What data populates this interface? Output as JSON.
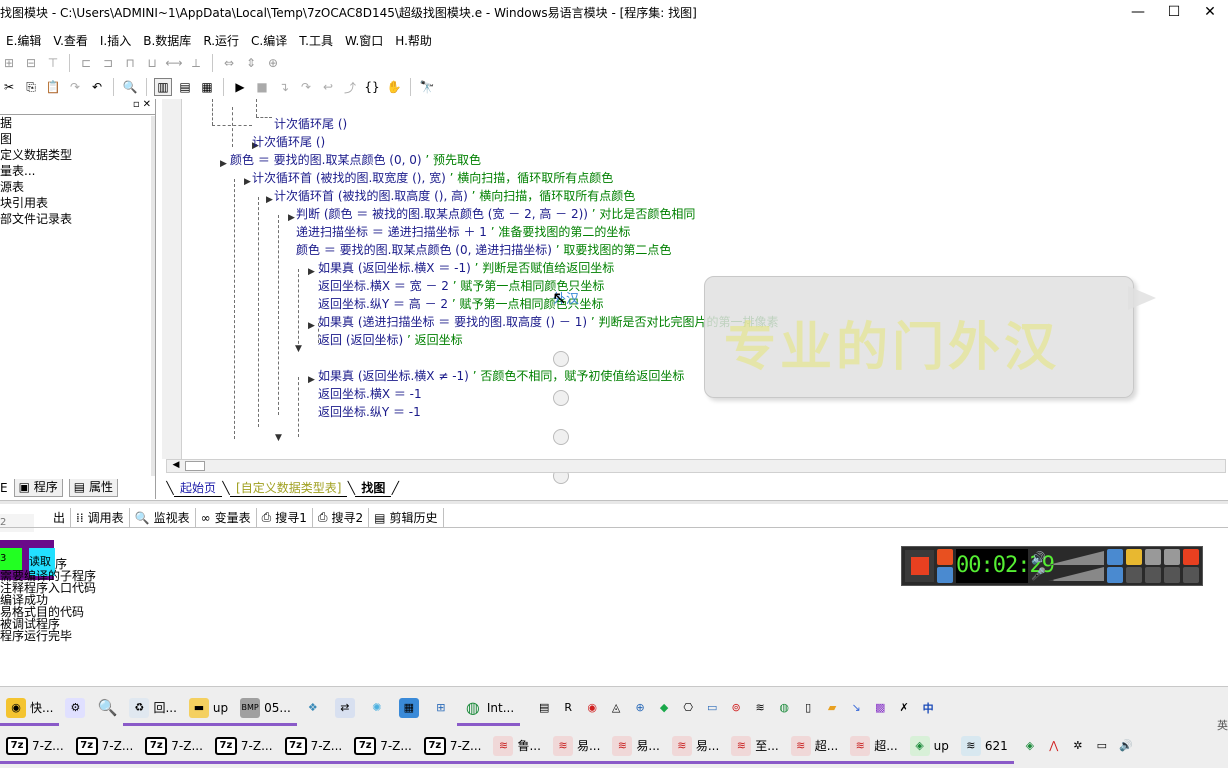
{
  "window": {
    "title": "找图模块 - C:\\Users\\ADMINI~1\\AppData\\Local\\Temp\\7zOCAC8D145\\超级找图模块.e - Windows易语言模块 - [程序集: 找图]",
    "minimize": "—",
    "maximize": "☐",
    "close": "✕"
  },
  "menu": {
    "items": [
      "E.编辑",
      "V.查看",
      "I.插入",
      "B.数据库",
      "R.运行",
      "C.编译",
      "T.工具",
      "W.窗口",
      "H.帮助"
    ]
  },
  "left_panel": {
    "tree": [
      "据",
      "图",
      "定义数据类型",
      "量表...",
      "源表",
      "块引用表",
      "部文件记录表"
    ],
    "tabs": [
      "程序",
      "属性"
    ],
    "tab_prefix": "E"
  },
  "code": {
    "lines": [
      {
        "kw": "计次循环尾 ()",
        "cm": ""
      },
      {
        "kw": "计次循环尾 ()",
        "cm": ""
      },
      {
        "kw": "颜色 ＝ 要找的图.取某点颜色 (0, 0)",
        "cm": "’ 预先取色"
      },
      {
        "kw": "计次循环首 (被找的图.取宽度 (), 宽)",
        "cm": "’ 横向扫描，循环取所有点颜色"
      },
      {
        "kw": "计次循环首 (被找的图.取高度 (), 高)",
        "cm": "’ 横向扫描，循环取所有点颜色"
      },
      {
        "kw": "判断 (颜色 ＝ 被找的图.取某点颜色 (宽 － 2, 高 － 2))",
        "cm": "’ 对比是否颜色相同"
      },
      {
        "kw": "递进扫描坐标 ＝ 递进扫描坐标 ＋ 1",
        "cm": "’ 准备要找图的第二的坐标"
      },
      {
        "kw": "颜色 ＝ 要找的图.取某点颜色 (0, 递进扫描坐标)",
        "cm": "’ 取要找图的第二点色"
      },
      {
        "kw": "如果真 (返回坐标.横X ＝ -1)",
        "cm": "’ 判断是否赋值给返回坐标"
      },
      {
        "kw": "返回坐标.横X ＝ 宽 － 2",
        "cm": "’ 赋予第一点相同颜色只坐标"
      },
      {
        "kw": "返回坐标.纵Y ＝ 高 － 2",
        "cm": "’ 赋予第一点相同颜色只坐标"
      },
      {
        "kw": "如果真 (递进扫描坐标 ＝ 要找的图.取高度 () － 1)",
        "cm": "’ 判断是否对比完图片的第一排像素"
      },
      {
        "kw": "返回 (返回坐标)",
        "cm": "’ 返回坐标"
      },
      {
        "kw": "如果真 (返回坐标.横X ≠ -1)",
        "cm": "’ 否颜色不相同，赋予初使值给返回坐标"
      },
      {
        "kw": "返回坐标.横X ＝ -1",
        "cm": ""
      },
      {
        "kw": "返回坐标.纵Y ＝ -1",
        "cm": ""
      }
    ]
  },
  "editor_tabs": [
    "起始页",
    "[自定义数据类型表]",
    "找图"
  ],
  "bottom_tabs": [
    "出",
    "调用表",
    "监视表",
    "变量表",
    "搜寻1",
    "搜寻2",
    "剪辑历史"
  ],
  "bottom_input_value": "2",
  "output": {
    "lines": [
      "序",
      "需要编译的子程序",
      "注释程序入口代码",
      "编译成功",
      "易格式目的代码",
      "被调试程序",
      "程序运行完毕"
    ],
    "green_label": "3",
    "cyan_label": "读取"
  },
  "recorder": {
    "timer": "00:02:29"
  },
  "bubble": {
    "text": "专业的门外汉",
    "cursor_label": "外汉"
  },
  "taskbar": {
    "row1": [
      {
        "icon": "chrome-icon",
        "label": "快..."
      },
      {
        "icon": "app-icon",
        "label": ""
      },
      {
        "icon": "search-app-icon",
        "label": ""
      },
      {
        "icon": "recycle-icon",
        "label": "回..."
      },
      {
        "icon": "folder-icon",
        "label": "up"
      },
      {
        "icon": "bmp-icon",
        "label": "05..."
      },
      {
        "icon": "app-icon",
        "label": ""
      },
      {
        "icon": "app-icon",
        "label": ""
      },
      {
        "icon": "app-icon",
        "label": ""
      },
      {
        "icon": "app-icon",
        "label": ""
      },
      {
        "icon": "network-icon",
        "label": ""
      },
      {
        "icon": "ie-icon",
        "label": "Int..."
      }
    ],
    "row2": [
      {
        "icon": "7z-icon",
        "label": "7-Z..."
      },
      {
        "icon": "7z-icon",
        "label": "7-Z..."
      },
      {
        "icon": "7z-icon",
        "label": "7-Z..."
      },
      {
        "icon": "7z-icon",
        "label": "7-Z..."
      },
      {
        "icon": "7z-icon",
        "label": "7-Z..."
      },
      {
        "icon": "7z-icon",
        "label": "7-Z..."
      },
      {
        "icon": "7z-icon",
        "label": "7-Z..."
      },
      {
        "icon": "e-icon",
        "label": "鲁..."
      },
      {
        "icon": "e-icon",
        "label": "易..."
      },
      {
        "icon": "e-icon",
        "label": "易..."
      },
      {
        "icon": "e-icon",
        "label": "易..."
      },
      {
        "icon": "e-icon",
        "label": "至..."
      },
      {
        "icon": "e-icon",
        "label": "超..."
      },
      {
        "icon": "e-icon",
        "label": "超..."
      },
      {
        "icon": "app-icon",
        "label": "up"
      },
      {
        "icon": "e-icon",
        "label": "621"
      }
    ],
    "tray_lang": "中",
    "tray_ime": "英"
  }
}
